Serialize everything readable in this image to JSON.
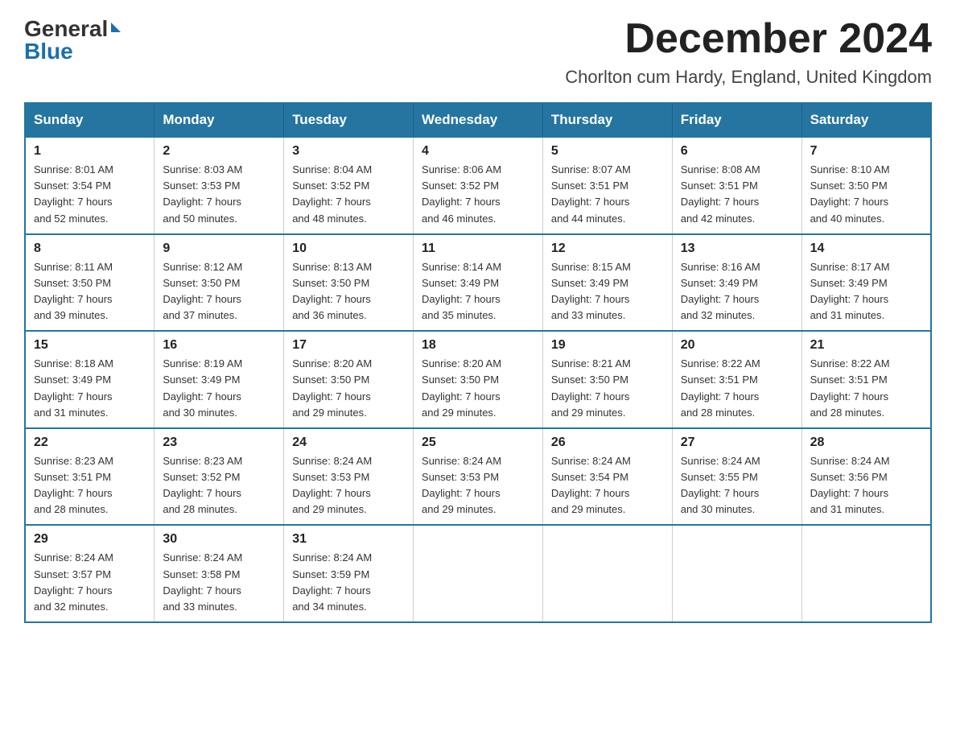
{
  "header": {
    "logo_general": "General",
    "logo_blue": "Blue",
    "month_title": "December 2024",
    "subtitle": "Chorlton cum Hardy, England, United Kingdom"
  },
  "days_of_week": [
    "Sunday",
    "Monday",
    "Tuesday",
    "Wednesday",
    "Thursday",
    "Friday",
    "Saturday"
  ],
  "weeks": [
    [
      {
        "day": "1",
        "sunrise": "8:01 AM",
        "sunset": "3:54 PM",
        "daylight": "7 hours and 52 minutes."
      },
      {
        "day": "2",
        "sunrise": "8:03 AM",
        "sunset": "3:53 PM",
        "daylight": "7 hours and 50 minutes."
      },
      {
        "day": "3",
        "sunrise": "8:04 AM",
        "sunset": "3:52 PM",
        "daylight": "7 hours and 48 minutes."
      },
      {
        "day": "4",
        "sunrise": "8:06 AM",
        "sunset": "3:52 PM",
        "daylight": "7 hours and 46 minutes."
      },
      {
        "day": "5",
        "sunrise": "8:07 AM",
        "sunset": "3:51 PM",
        "daylight": "7 hours and 44 minutes."
      },
      {
        "day": "6",
        "sunrise": "8:08 AM",
        "sunset": "3:51 PM",
        "daylight": "7 hours and 42 minutes."
      },
      {
        "day": "7",
        "sunrise": "8:10 AM",
        "sunset": "3:50 PM",
        "daylight": "7 hours and 40 minutes."
      }
    ],
    [
      {
        "day": "8",
        "sunrise": "8:11 AM",
        "sunset": "3:50 PM",
        "daylight": "7 hours and 39 minutes."
      },
      {
        "day": "9",
        "sunrise": "8:12 AM",
        "sunset": "3:50 PM",
        "daylight": "7 hours and 37 minutes."
      },
      {
        "day": "10",
        "sunrise": "8:13 AM",
        "sunset": "3:50 PM",
        "daylight": "7 hours and 36 minutes."
      },
      {
        "day": "11",
        "sunrise": "8:14 AM",
        "sunset": "3:49 PM",
        "daylight": "7 hours and 35 minutes."
      },
      {
        "day": "12",
        "sunrise": "8:15 AM",
        "sunset": "3:49 PM",
        "daylight": "7 hours and 33 minutes."
      },
      {
        "day": "13",
        "sunrise": "8:16 AM",
        "sunset": "3:49 PM",
        "daylight": "7 hours and 32 minutes."
      },
      {
        "day": "14",
        "sunrise": "8:17 AM",
        "sunset": "3:49 PM",
        "daylight": "7 hours and 31 minutes."
      }
    ],
    [
      {
        "day": "15",
        "sunrise": "8:18 AM",
        "sunset": "3:49 PM",
        "daylight": "7 hours and 31 minutes."
      },
      {
        "day": "16",
        "sunrise": "8:19 AM",
        "sunset": "3:49 PM",
        "daylight": "7 hours and 30 minutes."
      },
      {
        "day": "17",
        "sunrise": "8:20 AM",
        "sunset": "3:50 PM",
        "daylight": "7 hours and 29 minutes."
      },
      {
        "day": "18",
        "sunrise": "8:20 AM",
        "sunset": "3:50 PM",
        "daylight": "7 hours and 29 minutes."
      },
      {
        "day": "19",
        "sunrise": "8:21 AM",
        "sunset": "3:50 PM",
        "daylight": "7 hours and 29 minutes."
      },
      {
        "day": "20",
        "sunrise": "8:22 AM",
        "sunset": "3:51 PM",
        "daylight": "7 hours and 28 minutes."
      },
      {
        "day": "21",
        "sunrise": "8:22 AM",
        "sunset": "3:51 PM",
        "daylight": "7 hours and 28 minutes."
      }
    ],
    [
      {
        "day": "22",
        "sunrise": "8:23 AM",
        "sunset": "3:51 PM",
        "daylight": "7 hours and 28 minutes."
      },
      {
        "day": "23",
        "sunrise": "8:23 AM",
        "sunset": "3:52 PM",
        "daylight": "7 hours and 28 minutes."
      },
      {
        "day": "24",
        "sunrise": "8:24 AM",
        "sunset": "3:53 PM",
        "daylight": "7 hours and 29 minutes."
      },
      {
        "day": "25",
        "sunrise": "8:24 AM",
        "sunset": "3:53 PM",
        "daylight": "7 hours and 29 minutes."
      },
      {
        "day": "26",
        "sunrise": "8:24 AM",
        "sunset": "3:54 PM",
        "daylight": "7 hours and 29 minutes."
      },
      {
        "day": "27",
        "sunrise": "8:24 AM",
        "sunset": "3:55 PM",
        "daylight": "7 hours and 30 minutes."
      },
      {
        "day": "28",
        "sunrise": "8:24 AM",
        "sunset": "3:56 PM",
        "daylight": "7 hours and 31 minutes."
      }
    ],
    [
      {
        "day": "29",
        "sunrise": "8:24 AM",
        "sunset": "3:57 PM",
        "daylight": "7 hours and 32 minutes."
      },
      {
        "day": "30",
        "sunrise": "8:24 AM",
        "sunset": "3:58 PM",
        "daylight": "7 hours and 33 minutes."
      },
      {
        "day": "31",
        "sunrise": "8:24 AM",
        "sunset": "3:59 PM",
        "daylight": "7 hours and 34 minutes."
      },
      null,
      null,
      null,
      null
    ]
  ]
}
